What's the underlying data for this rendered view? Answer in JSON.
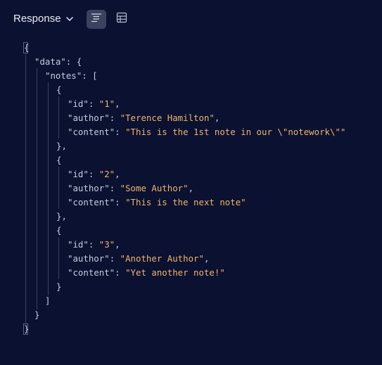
{
  "header": {
    "title": "Response",
    "view_modes": [
      {
        "name": "tree-view",
        "icon": "list-tree-icon",
        "active": true
      },
      {
        "name": "table-view",
        "icon": "table-grid-icon",
        "active": false
      }
    ]
  },
  "json_lines": [
    {
      "key": "",
      "sep": "",
      "value": "",
      "open": "{",
      "close": ""
    },
    {
      "key": "\"data\"",
      "sep": ": ",
      "value": "",
      "open": "{",
      "close": ""
    },
    {
      "key": "\"notes\"",
      "sep": ": ",
      "value": "",
      "open": "[",
      "close": ""
    },
    {
      "key": "",
      "sep": "",
      "value": "",
      "open": "{",
      "close": ""
    },
    {
      "key": "\"id\"",
      "sep": ": ",
      "value": "\"1\"",
      "open": "",
      "close": ","
    },
    {
      "key": "\"author\"",
      "sep": ": ",
      "value": "\"Terence Hamilton\"",
      "open": "",
      "close": ","
    },
    {
      "key": "\"content\"",
      "sep": ": ",
      "value": "\"This is the 1st note in our \\\"notework\\\"\"",
      "open": "",
      "close": ""
    },
    {
      "key": "",
      "sep": "",
      "value": "",
      "open": "},",
      "close": ""
    },
    {
      "key": "",
      "sep": "",
      "value": "",
      "open": "{",
      "close": ""
    },
    {
      "key": "\"id\"",
      "sep": ": ",
      "value": "\"2\"",
      "open": "",
      "close": ","
    },
    {
      "key": "\"author\"",
      "sep": ": ",
      "value": "\"Some Author\"",
      "open": "",
      "close": ","
    },
    {
      "key": "\"content\"",
      "sep": ": ",
      "value": "\"This is the next note\"",
      "open": "",
      "close": ""
    },
    {
      "key": "",
      "sep": "",
      "value": "",
      "open": "},",
      "close": ""
    },
    {
      "key": "",
      "sep": "",
      "value": "",
      "open": "{",
      "close": ""
    },
    {
      "key": "\"id\"",
      "sep": ": ",
      "value": "\"3\"",
      "open": "",
      "close": ","
    },
    {
      "key": "\"author\"",
      "sep": ": ",
      "value": "\"Another Author\"",
      "open": "",
      "close": ","
    },
    {
      "key": "\"content\"",
      "sep": ": ",
      "value": "\"Yet another note!\"",
      "open": "",
      "close": ""
    },
    {
      "key": "",
      "sep": "",
      "value": "",
      "open": "}",
      "close": ""
    },
    {
      "key": "",
      "sep": "",
      "value": "",
      "open": "]",
      "close": ""
    },
    {
      "key": "",
      "sep": "",
      "value": "",
      "open": "}",
      "close": ""
    },
    {
      "key": "",
      "sep": "",
      "value": "",
      "open": "}",
      "close": ""
    }
  ],
  "colors": {
    "background": "#0b1130",
    "string": "#f0b46c",
    "punctuation": "#c7cde0",
    "active_toggle": "#3a4260"
  }
}
